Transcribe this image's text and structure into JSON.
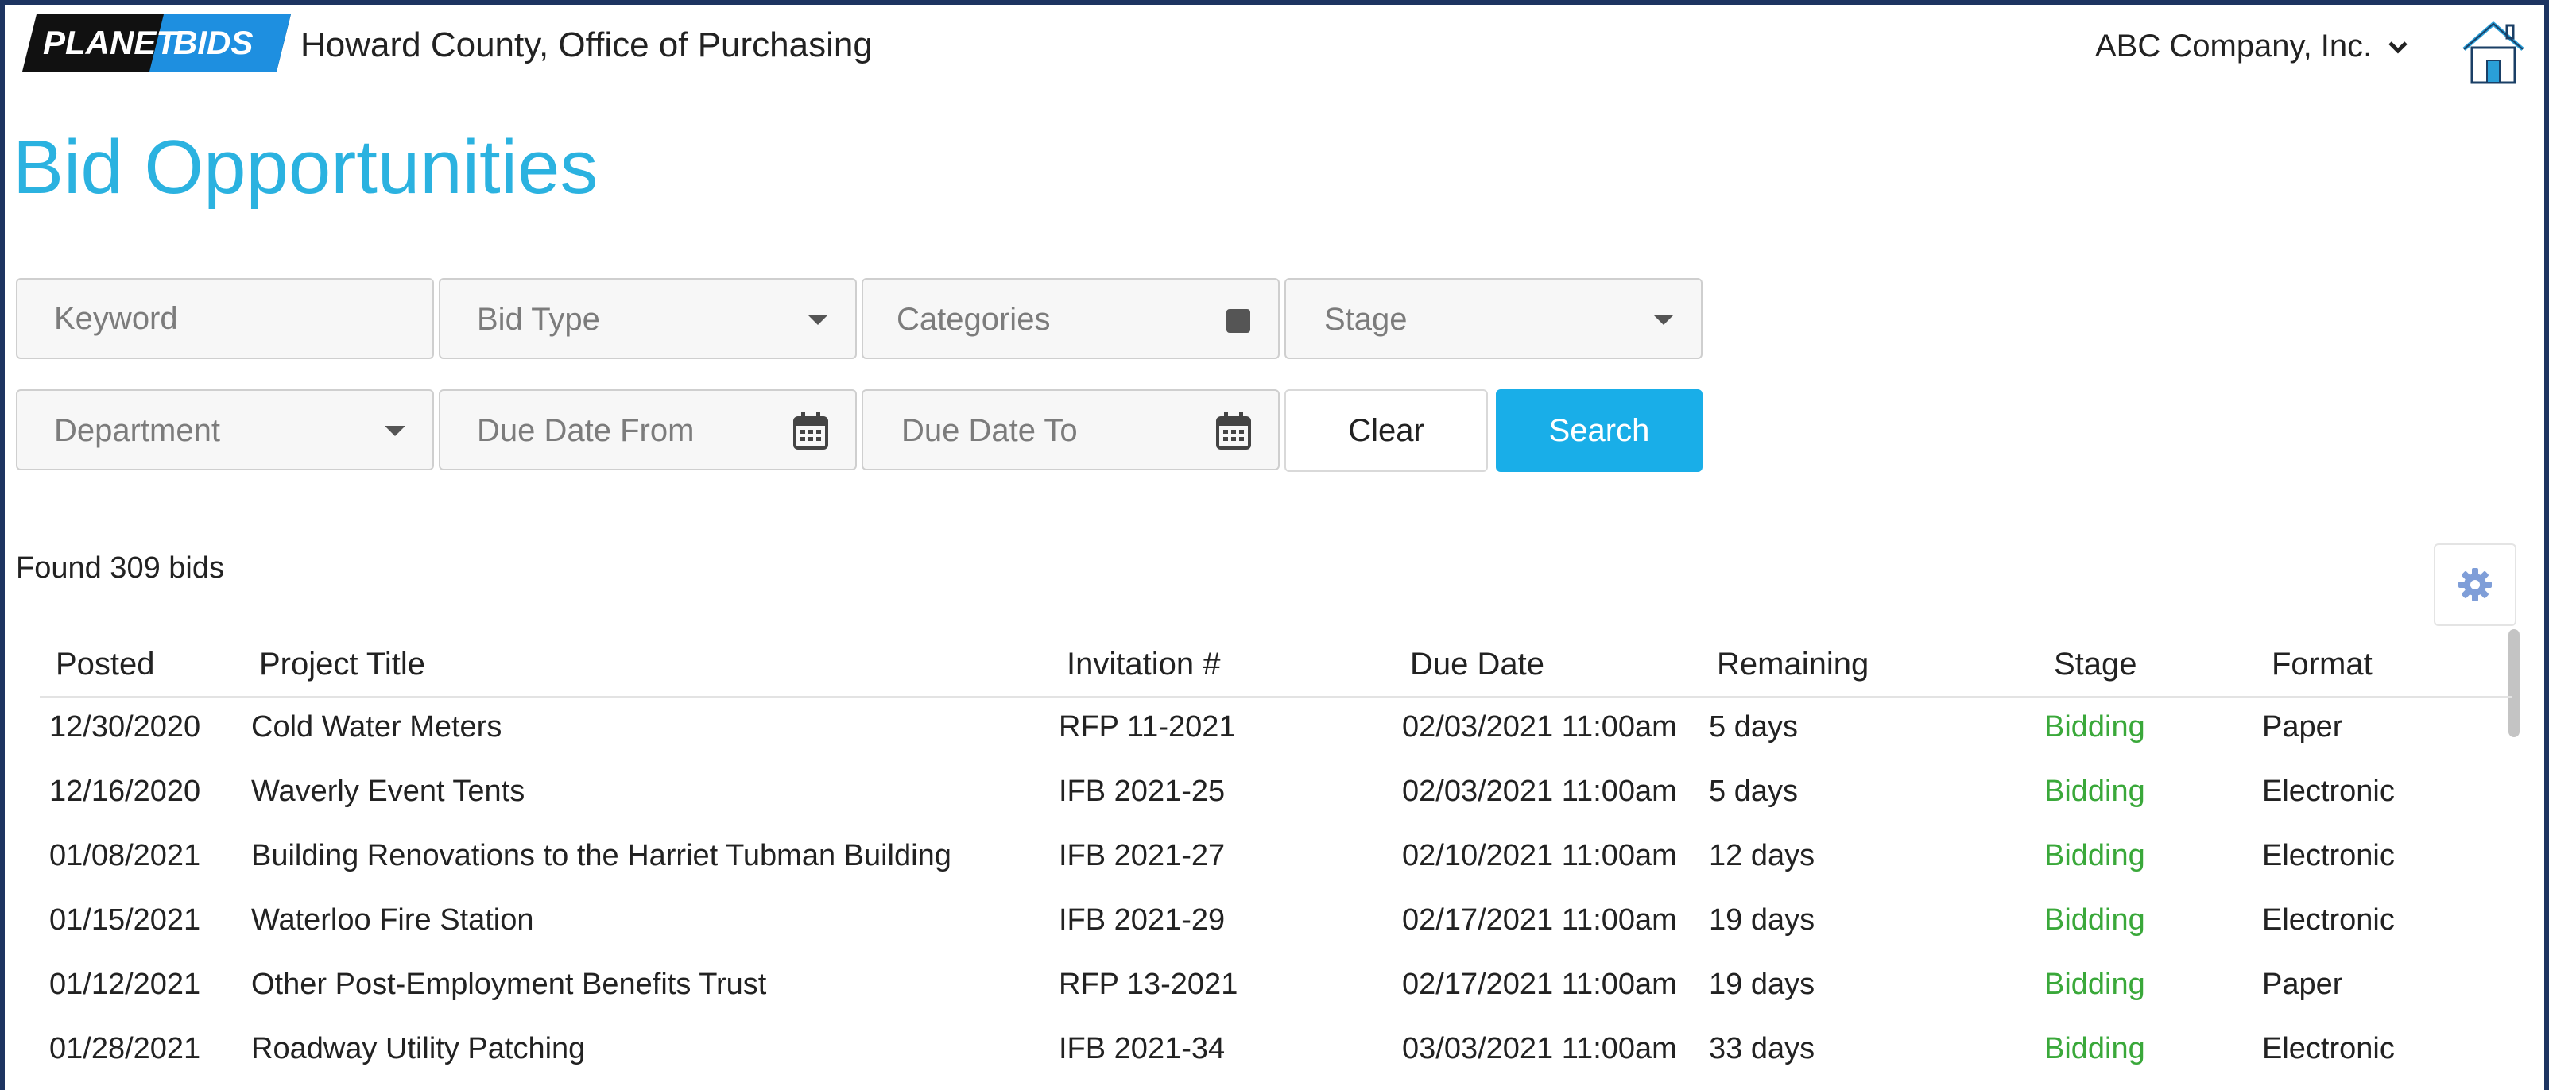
{
  "header": {
    "logo": {
      "part1": "PLANET",
      "part2": "BIDS"
    },
    "org_name": "Howard County, Office of Purchasing",
    "company": "ABC Company, Inc.",
    "home_icon": "home-icon"
  },
  "page_title": "Bid Opportunities",
  "filters": {
    "keyword_placeholder": "Keyword",
    "bid_type": "Bid Type",
    "categories": "Categories",
    "stage": "Stage",
    "department": "Department",
    "due_date_from": "Due Date From",
    "due_date_to": "Due Date To",
    "clear_label": "Clear",
    "search_label": "Search"
  },
  "found_text": "Found 309 bids",
  "table": {
    "columns": [
      "Posted",
      "Project Title",
      "Invitation #",
      "Due Date",
      "Remaining",
      "Stage",
      "Format"
    ],
    "rows": [
      {
        "posted": "12/30/2020",
        "title": "Cold Water Meters",
        "invitation": "RFP 11-2021",
        "due": "02/03/2021 11:00am",
        "remaining": "5 days",
        "stage": "Bidding",
        "format": "Paper"
      },
      {
        "posted": "12/16/2020",
        "title": "Waverly Event Tents",
        "invitation": "IFB 2021-25",
        "due": "02/03/2021 11:00am",
        "remaining": "5 days",
        "stage": "Bidding",
        "format": "Electronic"
      },
      {
        "posted": "01/08/2021",
        "title": "Building Renovations to the Harriet Tubman Building",
        "invitation": "IFB 2021-27",
        "due": "02/10/2021 11:00am",
        "remaining": "12 days",
        "stage": "Bidding",
        "format": "Electronic"
      },
      {
        "posted": "01/15/2021",
        "title": "Waterloo Fire Station",
        "invitation": "IFB 2021-29",
        "due": "02/17/2021 11:00am",
        "remaining": "19 days",
        "stage": "Bidding",
        "format": "Electronic"
      },
      {
        "posted": "01/12/2021",
        "title": "Other Post-Employment Benefits Trust",
        "invitation": "RFP 13-2021",
        "due": "02/17/2021 11:00am",
        "remaining": "19 days",
        "stage": "Bidding",
        "format": "Paper"
      },
      {
        "posted": "01/28/2021",
        "title": "Roadway Utility Patching",
        "invitation": "IFB 2021-34",
        "due": "03/03/2021 11:00am",
        "remaining": "33 days",
        "stage": "Bidding",
        "format": "Electronic"
      }
    ]
  },
  "colors": {
    "accent": "#2bb2e0",
    "search_button": "#19aee8",
    "stage_green": "#3aa83a",
    "frame": "#1d3461"
  }
}
